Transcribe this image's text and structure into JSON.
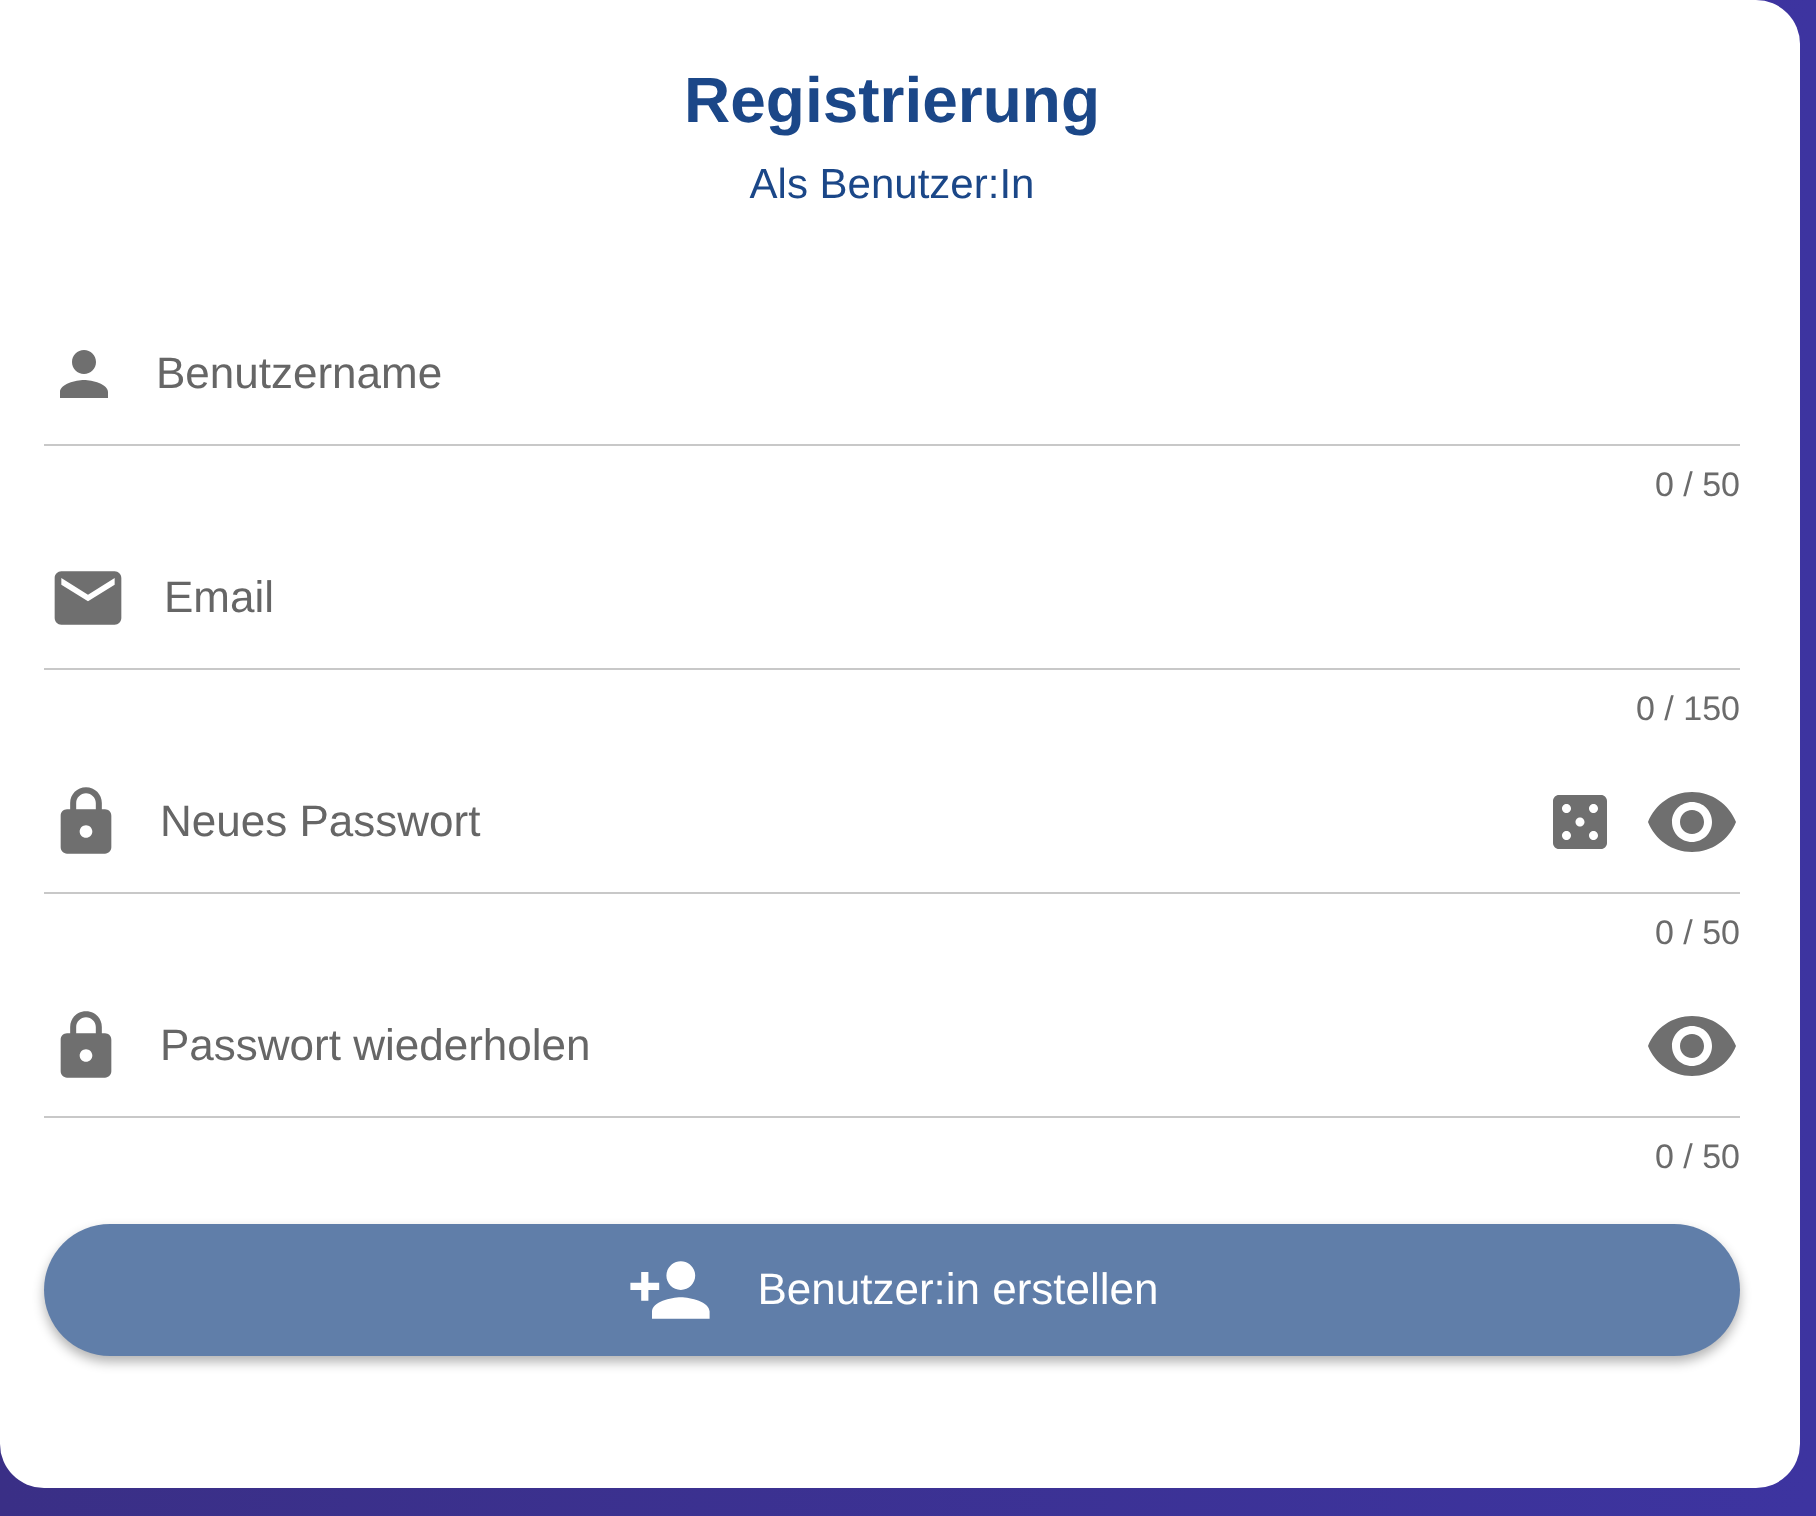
{
  "title": "Registrierung",
  "subtitle": "Als Benutzer:In",
  "fields": [
    {
      "kind": "user",
      "placeholder": "Benutzername",
      "counter": "0 / 50"
    },
    {
      "kind": "email",
      "placeholder": "Email",
      "counter": "0 / 150"
    },
    {
      "kind": "new_password",
      "placeholder": "Neues Passwort",
      "counter": "0 / 50"
    },
    {
      "kind": "password",
      "placeholder": "Passwort wiederholen",
      "counter": "0 / 50"
    }
  ],
  "button": "Benutzer:in erstellen"
}
